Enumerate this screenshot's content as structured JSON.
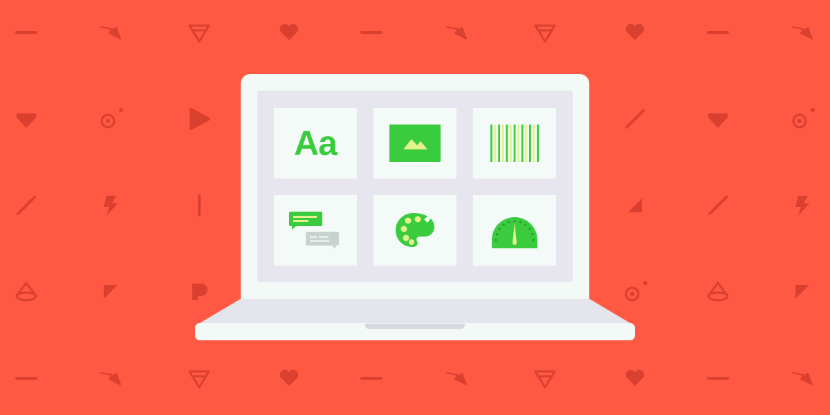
{
  "colors": {
    "background": "#FF5843",
    "pattern_icon": "#D9402F",
    "laptop_body": "#F3F9F6",
    "laptop_base_top": "#E4E4EC",
    "laptop_shadow": "#D8D8E2",
    "screen": "#E7E6EE",
    "tile": "#F4FAF7",
    "accent_green": "#3ACB3E",
    "accent_yellow": "#E4F28A",
    "muted_gray": "#C8D2D0"
  },
  "tiles": [
    {
      "id": "typography",
      "icon": "typography-icon",
      "text": "Aa"
    },
    {
      "id": "image",
      "icon": "image-icon"
    },
    {
      "id": "pattern",
      "icon": "striped-pattern-icon"
    },
    {
      "id": "chat",
      "icon": "chat-bubbles-icon"
    },
    {
      "id": "palette",
      "icon": "color-palette-icon"
    },
    {
      "id": "gauge",
      "icon": "speed-gauge-icon"
    }
  ],
  "background_icons": [
    "minus-icon",
    "lightning-icon",
    "ice-cream-cone-icon",
    "heart-icon",
    "diamond-icon",
    "target-icon",
    "play-icon",
    "slash-icon",
    "triangle-icon",
    "cone-icon",
    "corner-icon"
  ]
}
